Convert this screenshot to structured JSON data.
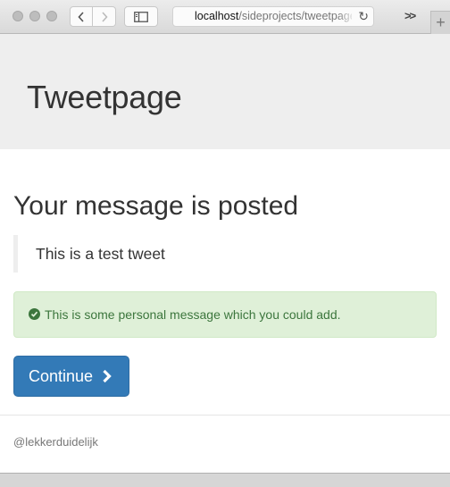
{
  "browser": {
    "url_host": "localhost",
    "url_path": "/sideprojects/tweetpage",
    "overflow_label": ">>",
    "new_tab_label": "+"
  },
  "site": {
    "title": "Tweetpage"
  },
  "main": {
    "heading": "Your message is posted",
    "tweet": "This is a test tweet",
    "alert": "This is some personal message which you could add.",
    "continue_label": "Continue"
  },
  "footer": {
    "handle": "@lekkerduidelijk"
  },
  "colors": {
    "jumbotron_bg": "#eeeeee",
    "alert_bg": "#dff0d8",
    "alert_text": "#3c763d",
    "button_bg": "#337ab7"
  }
}
